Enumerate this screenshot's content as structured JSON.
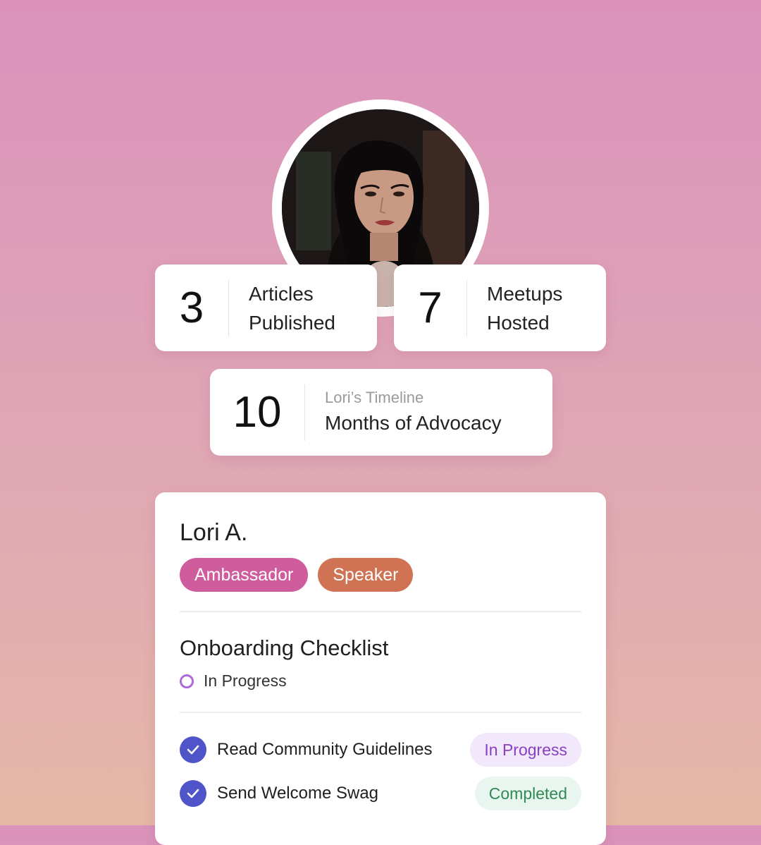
{
  "profile": {
    "avatar_alt": "Lori A."
  },
  "stats": {
    "articles": {
      "value": "3",
      "label_line1": "Articles",
      "label_line2": "Published"
    },
    "meetups": {
      "value": "7",
      "label_line1": "Meetups",
      "label_line2": "Hosted"
    },
    "months": {
      "value": "10",
      "subtitle": "Lori’s Timeline",
      "label": "Months of Advocacy"
    }
  },
  "card": {
    "name": "Lori A.",
    "badges": [
      {
        "label": "Ambassador",
        "color": "#cf5c9c"
      },
      {
        "label": "Speaker",
        "color": "#cf7354"
      }
    ],
    "checklist": {
      "title": "Onboarding Checklist",
      "status": "In Progress",
      "tasks": [
        {
          "label": "Read Community Guidelines",
          "status": "In Progress",
          "checked": true
        },
        {
          "label": "Send Welcome Swag",
          "status": "Completed",
          "checked": true
        }
      ]
    }
  },
  "colors": {
    "accent_check": "#4f55c8",
    "progress_purple": "#8a3fc2",
    "complete_green": "#2f8a55"
  }
}
